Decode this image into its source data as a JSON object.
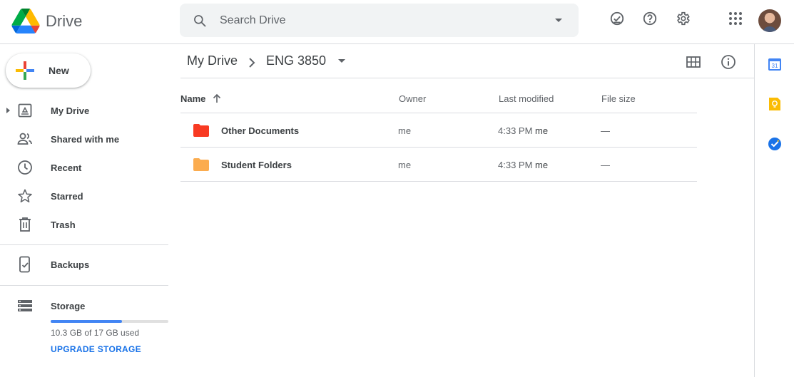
{
  "app": {
    "name": "Drive"
  },
  "search": {
    "placeholder": "Search Drive"
  },
  "header_icons": [
    "offline-status-icon",
    "help-icon",
    "settings-icon",
    "apps-grid-icon",
    "account-avatar"
  ],
  "sidebar": {
    "new_label": "New",
    "items": [
      {
        "label": "My Drive",
        "icon": "my-drive-icon"
      },
      {
        "label": "Shared with me",
        "icon": "shared-icon"
      },
      {
        "label": "Recent",
        "icon": "clock-icon"
      },
      {
        "label": "Starred",
        "icon": "star-icon"
      },
      {
        "label": "Trash",
        "icon": "trash-icon"
      }
    ],
    "backups_label": "Backups",
    "storage": {
      "label": "Storage",
      "used_text": "10.3 GB of 17 GB used",
      "used_fraction": 0.606,
      "upgrade_label": "UPGRADE STORAGE"
    }
  },
  "breadcrumb": {
    "root": "My Drive",
    "current": "ENG 3850"
  },
  "table": {
    "columns": {
      "name": "Name",
      "owner": "Owner",
      "modified": "Last modified",
      "size": "File size"
    },
    "rows": [
      {
        "name": "Other Documents",
        "owner": "me",
        "modified": "4:33 PM",
        "modified_by": "me",
        "size": "—",
        "color": "#f83a22"
      },
      {
        "name": "Student Folders",
        "owner": "me",
        "modified": "4:33 PM",
        "modified_by": "me",
        "size": "—",
        "color": "#fbac4f"
      }
    ]
  },
  "colors": {
    "accent": "#1a73e8",
    "storage_fill": "#4285f4"
  }
}
